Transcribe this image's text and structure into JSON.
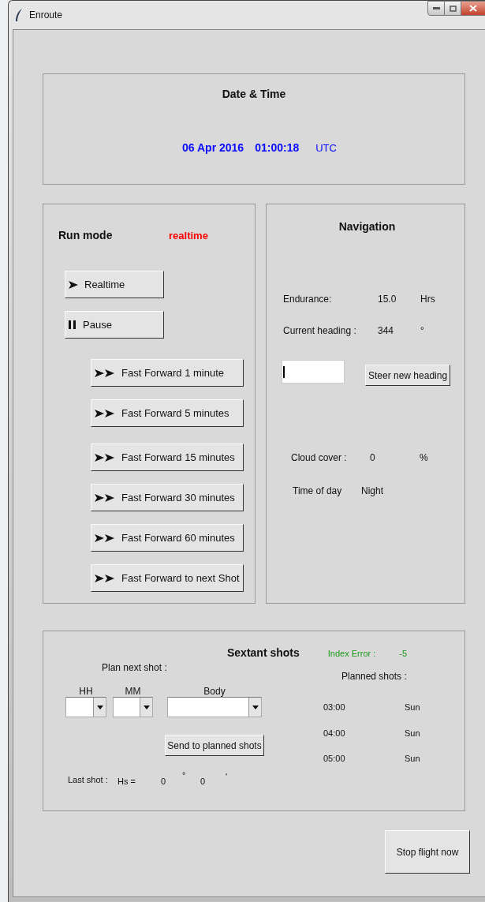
{
  "window": {
    "title": "Enroute"
  },
  "date_time": {
    "title": "Date & Time",
    "date": "06 Apr 2016",
    "time": "01:00:18",
    "zone": "UTC"
  },
  "run_mode": {
    "label": "Run mode",
    "value": "realtime",
    "buttons": [
      {
        "kind": "play",
        "label": "Realtime"
      },
      {
        "kind": "pause",
        "label": "Pause"
      },
      {
        "kind": "fast_forward",
        "label": "Fast Forward 1 minute"
      },
      {
        "kind": "fast_forward",
        "label": "Fast Forward 5 minutes"
      },
      {
        "kind": "fast_forward",
        "label": "Fast Forward 15 minutes"
      },
      {
        "kind": "fast_forward",
        "label": "Fast Forward 30 minutes"
      },
      {
        "kind": "fast_forward",
        "label": "Fast Forward 60 minutes"
      },
      {
        "kind": "fast_forward",
        "label": "Fast Forward to next Shot"
      }
    ]
  },
  "navigation": {
    "title": "Navigation",
    "rows": [
      {
        "label": "Endurance:",
        "value": "15.0",
        "unit": "Hrs"
      },
      {
        "label": "Current heading :",
        "value": "344",
        "unit": "°"
      }
    ],
    "steer_button": "Steer new heading",
    "conditions": [
      {
        "label": "Cloud cover :",
        "value": "0",
        "unit": "%"
      },
      {
        "label": "Time of day",
        "value": "Night"
      }
    ]
  },
  "sextant": {
    "title": "Sextant shots",
    "index_error_label": "Index Error :",
    "index_error": "-5",
    "plan_label": "Plan next shot :",
    "fields": [
      {
        "label": "HH"
      },
      {
        "label": "MM"
      },
      {
        "label": "Body"
      }
    ],
    "send_button": "Send to planned shots",
    "last_shot": {
      "label": "Last shot :",
      "hs_label": "Hs =",
      "degrees": "0",
      "degree_sign": "°",
      "minutes": "0",
      "minute_sign": "'"
    },
    "planned_label": "Planned shots :",
    "planned": [
      {
        "time": "03:00",
        "body": "Sun"
      },
      {
        "time": "04:00",
        "body": "Sun"
      },
      {
        "time": "05:00",
        "body": "Sun"
      }
    ]
  },
  "stop_button": "Stop flight now"
}
